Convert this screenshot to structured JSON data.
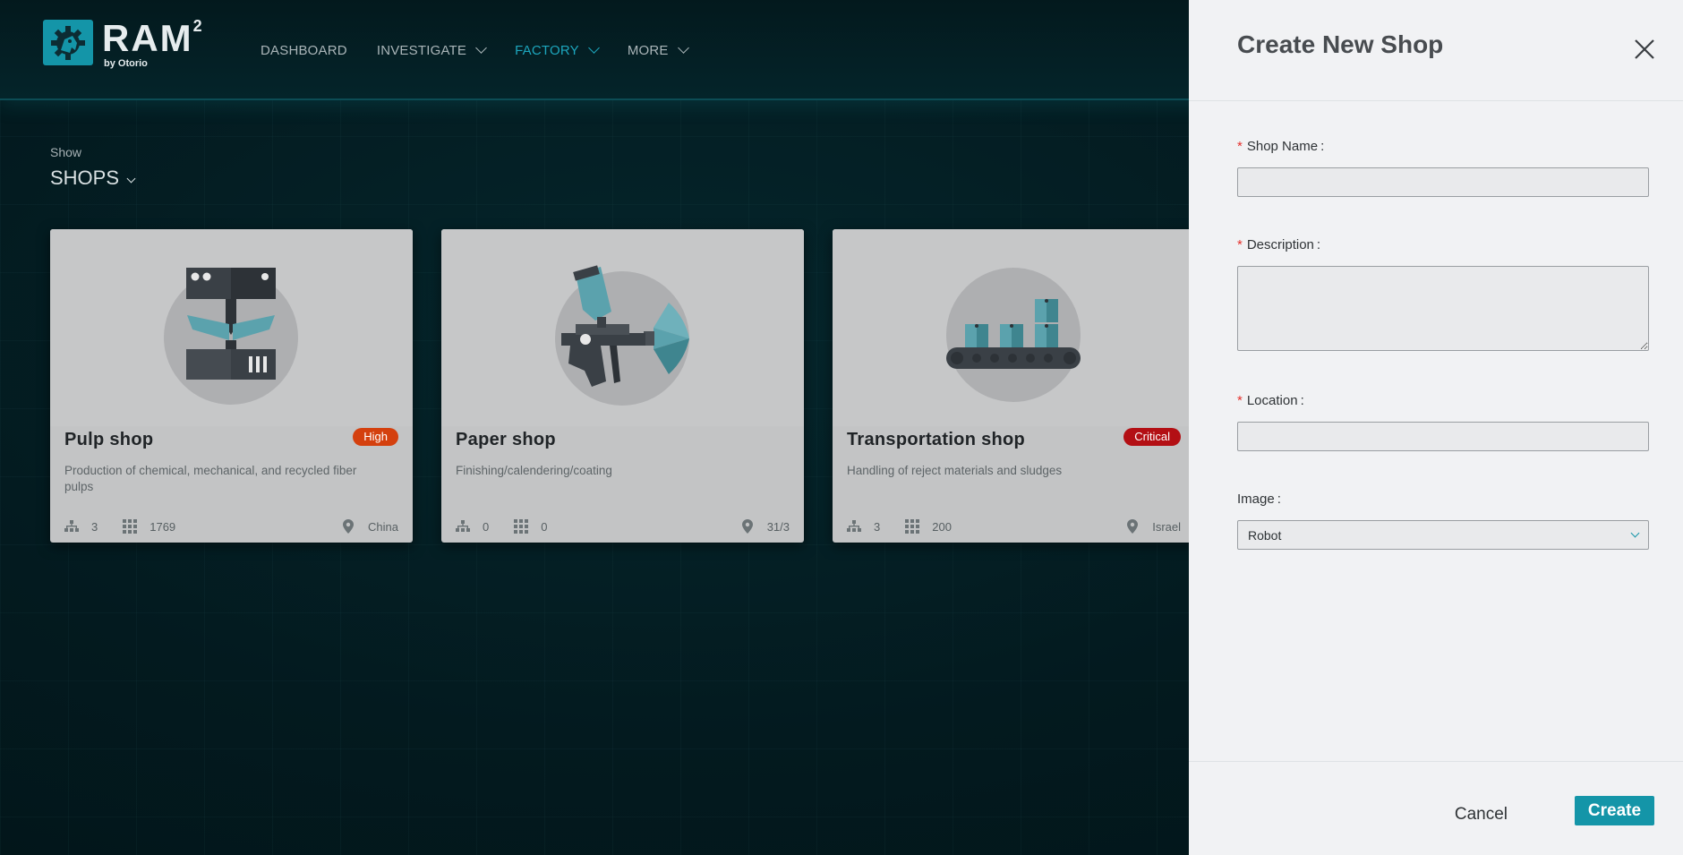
{
  "app": {
    "logo_title": "RAM",
    "logo_superscript": "2",
    "logo_subtitle": "by Otorio"
  },
  "nav": {
    "items": [
      {
        "label": "DASHBOARD",
        "has_dropdown": false,
        "active": false
      },
      {
        "label": "INVESTIGATE",
        "has_dropdown": true,
        "active": false
      },
      {
        "label": "FACTORY",
        "has_dropdown": true,
        "active": true
      },
      {
        "label": "MORE",
        "has_dropdown": true,
        "active": false
      }
    ]
  },
  "filter": {
    "label": "Show",
    "value": "SHOPS"
  },
  "cards": [
    {
      "name": "Pulp shop",
      "badge": "High",
      "badge_color": "#d4400e",
      "description": "Production of chemical, mechanical, and recycled fiber pulps",
      "zones": "3",
      "assets": "1769",
      "location": "China",
      "image": "press-machine-icon"
    },
    {
      "name": "Paper shop",
      "badge": "",
      "badge_color": "",
      "description": "Finishing/calendering/coating",
      "zones": "0",
      "assets": "0",
      "location": "31/3",
      "image": "spray-gun-icon"
    },
    {
      "name": "Transportation shop",
      "badge": "Critical",
      "badge_color": "#b30f14",
      "description": "Handling of reject materials and sludges",
      "zones": "3",
      "assets": "200",
      "location": "Israel",
      "image": "conveyor-belt-icon"
    }
  ],
  "drawer": {
    "title": "Create New Shop",
    "fields": {
      "shop_name": {
        "label": "Shop Name",
        "required": true,
        "value": ""
      },
      "description": {
        "label": "Description",
        "required": true,
        "value": ""
      },
      "location": {
        "label": "Location",
        "required": true,
        "value": ""
      },
      "image": {
        "label": "Image",
        "required": false,
        "value": "Robot"
      }
    },
    "required_marker": "*",
    "label_suffix": ":",
    "cancel_label": "Cancel",
    "create_label": "Create"
  },
  "colors": {
    "accent": "#1495a8",
    "high": "#d4400e",
    "critical": "#b30f14",
    "required": "#e5302c"
  }
}
